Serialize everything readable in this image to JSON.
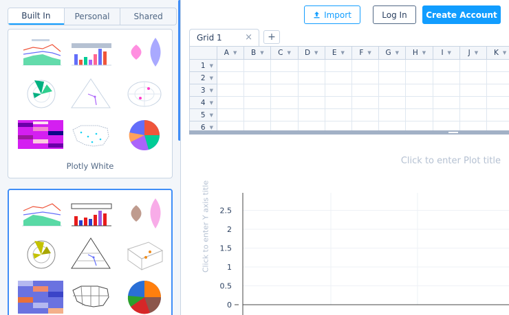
{
  "left_panel": {
    "tabs": [
      "Built In",
      "Personal",
      "Shared"
    ],
    "active_tab": "Built In",
    "themes": [
      {
        "name": "Plotly White",
        "selected": false
      },
      {
        "name": "",
        "selected": true
      }
    ]
  },
  "topbar": {
    "import_label": "Import",
    "login_label": "Log In",
    "create_label": "Create Account"
  },
  "grid": {
    "tab_label": "Grid 1",
    "close_glyph": "×",
    "add_glyph": "+",
    "columns": [
      "A",
      "B",
      "C",
      "D",
      "E",
      "F",
      "G",
      "H",
      "I",
      "J",
      "K"
    ],
    "rows": [
      "1",
      "2",
      "3",
      "4",
      "5",
      "6"
    ]
  },
  "plot": {
    "title_placeholder": "Click to enter Plot title",
    "yaxis_placeholder": "Click to enter Y axis title",
    "y_ticks": [
      "2.5",
      "2",
      "1.5",
      "1",
      "0.5",
      "0"
    ]
  },
  "colors": {
    "accent": "#119dff",
    "selected_border": "#3f8df7",
    "panel_bg": "#f3f6fa",
    "border": "#c8d4e3"
  }
}
